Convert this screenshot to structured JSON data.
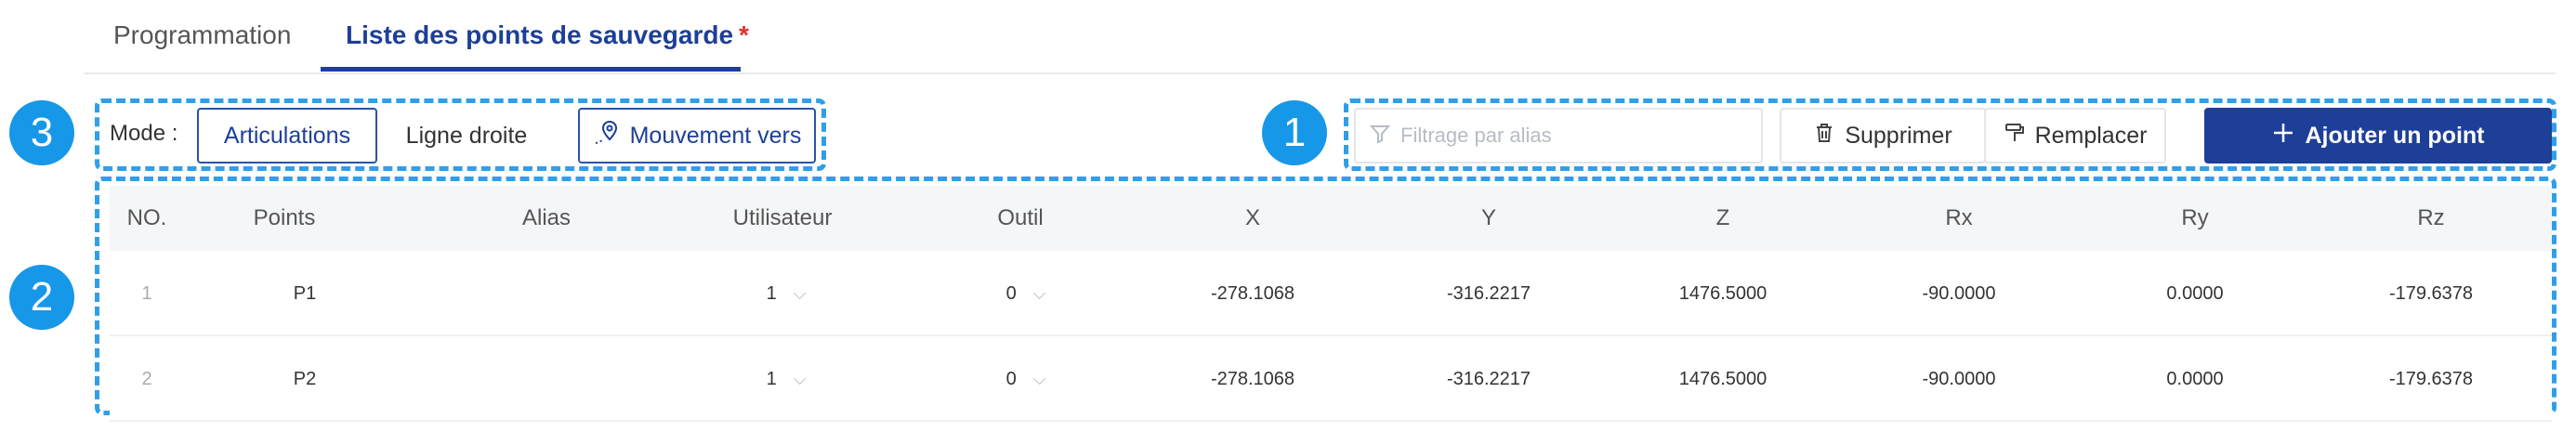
{
  "tabs": [
    {
      "label": "Programmation"
    },
    {
      "label": "Liste des points de sauvegarde",
      "modified_marker": "*"
    }
  ],
  "callouts": [
    "1",
    "2",
    "3"
  ],
  "mode": {
    "label": "Mode :",
    "options": [
      "Articulations",
      "Ligne droite"
    ],
    "selected": "Articulations",
    "move_to_label": "Mouvement vers"
  },
  "toolbar": {
    "filter_placeholder": "Filtrage par alias",
    "filter_value": "",
    "delete_label": "Supprimer",
    "replace_label": "Remplacer",
    "add_label": "Ajouter un point"
  },
  "table": {
    "columns": [
      "NO.",
      "Points",
      "Alias",
      "Utilisateur",
      "Outil",
      "X",
      "Y",
      "Z",
      "Rx",
      "Ry",
      "Rz"
    ],
    "rows": [
      {
        "no": "1",
        "point": "P1",
        "alias": "",
        "user": "1",
        "tool": "0",
        "x": "-278.1068",
        "y": "-316.2217",
        "z": "1476.5000",
        "rx": "-90.0000",
        "ry": "0.0000",
        "rz": "-179.6378"
      },
      {
        "no": "2",
        "point": "P2",
        "alias": "",
        "user": "1",
        "tool": "0",
        "x": "-278.1068",
        "y": "-316.2217",
        "z": "1476.5000",
        "rx": "-90.0000",
        "ry": "0.0000",
        "rz": "-179.6378"
      }
    ]
  },
  "colors": {
    "primary": "#1d3f98",
    "callout": "#1797e8",
    "dashed_outline": "#2f9fe8",
    "asterisk": "#e0302b"
  },
  "icons": [
    "location-route-icon",
    "filter-icon",
    "trash-icon",
    "paint-roller-icon",
    "plus-icon",
    "chevron-down-icon"
  ]
}
